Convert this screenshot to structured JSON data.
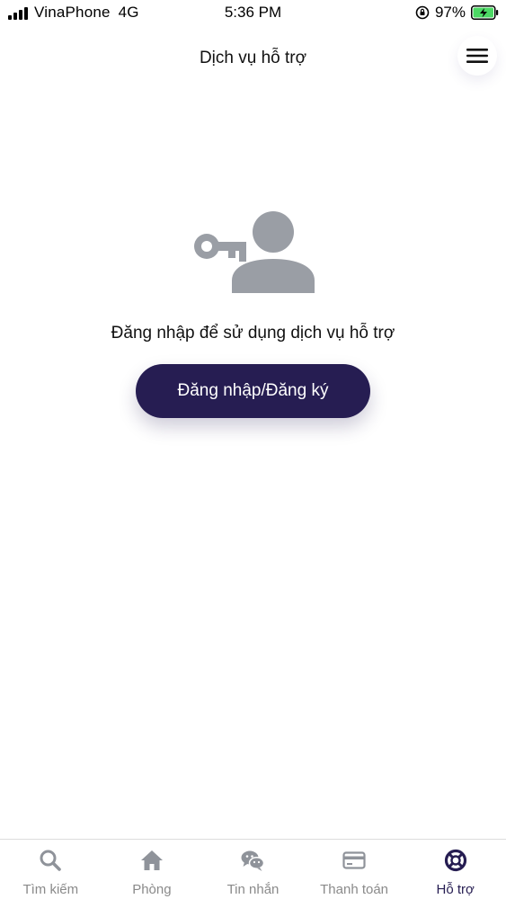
{
  "status_bar": {
    "carrier": "VinaPhone",
    "network": "4G",
    "time": "5:36 PM",
    "battery_percent": "97%"
  },
  "header": {
    "title": "Dịch vụ hỗ trợ",
    "menu_icon": "hamburger-menu-icon"
  },
  "main": {
    "illustration_icon": "key-user-icon",
    "message": "Đăng nhập để sử dụng dịch vụ hỗ trợ",
    "login_button_label": "Đăng nhập/Đăng ký"
  },
  "tab_bar": {
    "items": [
      {
        "label": "Tìm kiếm",
        "icon": "search-icon",
        "active": false
      },
      {
        "label": "Phòng",
        "icon": "home-icon",
        "active": false
      },
      {
        "label": "Tin nhắn",
        "icon": "chat-icon",
        "active": false
      },
      {
        "label": "Thanh toán",
        "icon": "credit-card-icon",
        "active": false
      },
      {
        "label": "Hỗ trợ",
        "icon": "lifebuoy-icon",
        "active": true
      }
    ]
  },
  "colors": {
    "accent": "#261d52",
    "icon_gray": "#9a9ea5",
    "inactive_label": "#8a8a8a",
    "battery_green": "#4cd964"
  }
}
